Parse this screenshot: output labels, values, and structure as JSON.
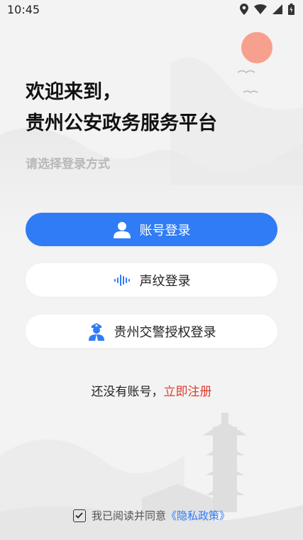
{
  "status_bar": {
    "time": "10:45"
  },
  "welcome": {
    "line1": "欢迎来到，",
    "line2": "贵州公安政务服务平台"
  },
  "subtitle": "请选择登录方式",
  "buttons": {
    "account": "账号登录",
    "voice": "声纹登录",
    "traffic": "贵州交警授权登录"
  },
  "register": {
    "prompt": "还没有账号，",
    "link": "立即注册"
  },
  "agreement": {
    "text": "我已阅读并同意",
    "policy": "《隐私政策》"
  },
  "colors": {
    "primary": "#2f7cf6",
    "link_red": "#e23b2e",
    "sun": "#f7a08e"
  },
  "icons": [
    "location-icon",
    "wifi-icon",
    "signal-icon",
    "battery-icon",
    "user-icon",
    "voiceprint-icon",
    "police-icon",
    "checkbox-icon"
  ]
}
